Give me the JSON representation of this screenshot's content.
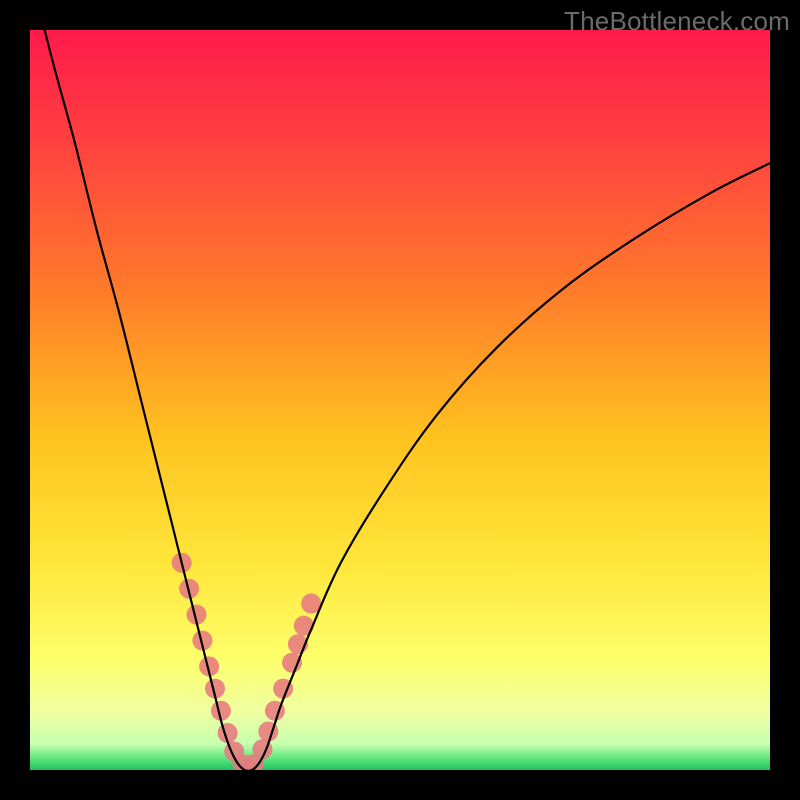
{
  "watermark": "TheBottleneck.com",
  "colors": {
    "frame": "#000000",
    "curve": "#000000",
    "marker": "#e77a7f",
    "gradient_stops": [
      {
        "pos": 0.0,
        "color": "#ff1a4a"
      },
      {
        "pos": 0.15,
        "color": "#ff4040"
      },
      {
        "pos": 0.35,
        "color": "#ff7a2a"
      },
      {
        "pos": 0.55,
        "color": "#ffc21f"
      },
      {
        "pos": 0.72,
        "color": "#ffe63a"
      },
      {
        "pos": 0.85,
        "color": "#fdff6b"
      },
      {
        "pos": 0.92,
        "color": "#f0ffa0"
      },
      {
        "pos": 0.965,
        "color": "#c7ffb0"
      },
      {
        "pos": 0.985,
        "color": "#5be67a"
      },
      {
        "pos": 1.0,
        "color": "#20c060"
      }
    ]
  },
  "chart_data": {
    "type": "line",
    "title": "",
    "xlabel": "",
    "ylabel": "",
    "xlim": [
      0,
      100
    ],
    "ylim": [
      0,
      100
    ],
    "description": "V-shaped bottleneck curve with minimum near x≈29; y is bottleneck percentage (0 at the notch, ~100 at extremes). Background gradient maps y: red high → yellow mid → green 0.",
    "series": [
      {
        "name": "bottleneck-curve",
        "x": [
          0,
          3,
          6,
          9,
          12,
          15,
          18,
          20,
          22,
          24,
          25,
          26,
          27,
          28,
          29,
          30,
          31,
          32,
          33,
          34,
          36,
          38,
          42,
          48,
          55,
          63,
          72,
          82,
          92,
          100
        ],
        "y": [
          108,
          96,
          85,
          73,
          62,
          50,
          38,
          30,
          22,
          14,
          10,
          6,
          3,
          1,
          0,
          0,
          1,
          3,
          6,
          9,
          14,
          19,
          28,
          38,
          48,
          57,
          65,
          72,
          78,
          82
        ]
      }
    ],
    "markers": {
      "name": "highlighted-range-dots",
      "x": [
        20.5,
        21.5,
        22.5,
        23.3,
        24.2,
        25.0,
        25.8,
        26.7,
        27.6,
        28.7,
        30.2,
        31.4,
        32.2,
        33.1,
        34.2,
        35.4,
        36.2,
        37.0,
        38.0
      ],
      "y": [
        28.0,
        24.5,
        21.0,
        17.5,
        14.0,
        11.0,
        8.0,
        5.0,
        2.5,
        0.8,
        0.8,
        2.8,
        5.2,
        8.0,
        11.0,
        14.5,
        17.0,
        19.5,
        22.5
      ]
    }
  }
}
